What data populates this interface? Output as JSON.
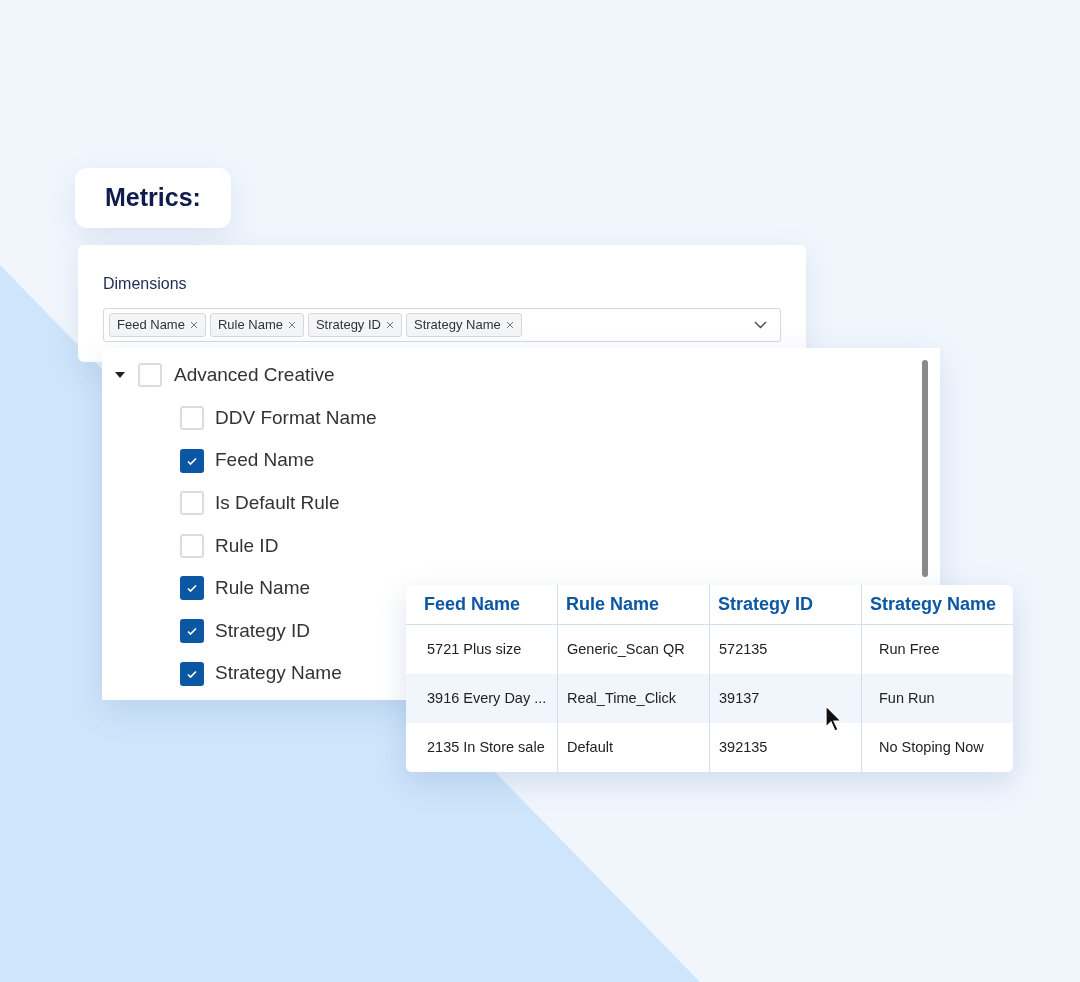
{
  "title": "Metrics:",
  "dimensions": {
    "label": "Dimensions",
    "tags": [
      "Feed Name",
      "Rule Name",
      "Strategy ID",
      "Strategy Name"
    ]
  },
  "tree": {
    "label": "Advanced Creative",
    "expanded": true,
    "checked": false,
    "children": [
      {
        "label": "DDV Format Name",
        "checked": false
      },
      {
        "label": "Feed Name",
        "checked": true
      },
      {
        "label": "Is Default Rule",
        "checked": false
      },
      {
        "label": "Rule ID",
        "checked": false
      },
      {
        "label": "Rule Name",
        "checked": true
      },
      {
        "label": "Strategy ID",
        "checked": true
      },
      {
        "label": "Strategy Name",
        "checked": true
      }
    ]
  },
  "table": {
    "columns": [
      "Feed Name",
      "Rule Name",
      "Strategy ID",
      "Strategy Name"
    ],
    "rows": [
      {
        "cells": [
          "5721 Plus size",
          "Generic_Scan QR",
          "572135",
          "Run Free"
        ],
        "highlighted": false
      },
      {
        "cells": [
          "3916 Every Day ...",
          "Real_Time_Click",
          "39137",
          "Fun Run"
        ],
        "highlighted": true
      },
      {
        "cells": [
          "2135 In Store sale",
          "Default",
          "392135",
          "No Stoping Now"
        ],
        "highlighted": false
      }
    ]
  }
}
